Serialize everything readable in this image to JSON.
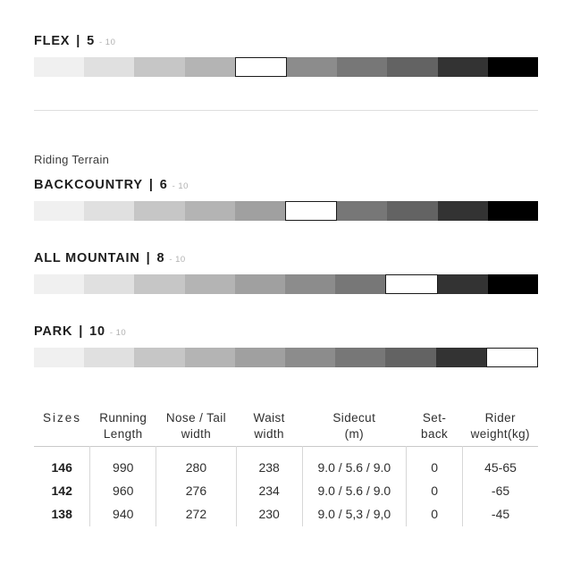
{
  "flex": {
    "name": "FLEX",
    "separator": "|",
    "value": "5",
    "max": "- 10",
    "rating": 5,
    "scale_steps": 10
  },
  "riding_terrain": {
    "label": "Riding Terrain",
    "items": [
      {
        "name": "BACKCOUNTRY",
        "separator": "|",
        "value": "6",
        "max": "- 10",
        "rating": 6,
        "scale_steps": 10
      },
      {
        "name": "ALL MOUNTAIN",
        "separator": "|",
        "value": "8",
        "max": "- 10",
        "rating": 8,
        "scale_steps": 10
      },
      {
        "name": "PARK",
        "separator": "|",
        "value": "10",
        "max": "- 10",
        "rating": 10,
        "scale_steps": 10
      }
    ]
  },
  "scale_colors": [
    "#f0f0f0",
    "#e0e0e0",
    "#c6c6c6",
    "#b4b4b4",
    "#a0a0a0",
    "#8c8c8c",
    "#777777",
    "#636363",
    "#333333",
    "#000000"
  ],
  "spec_table": {
    "headers": [
      "Sizes",
      "Running\nLength",
      "Nose / Tail\nwidth",
      "Waist\nwidth",
      "Sidecut\n(m)",
      "Set-\nback",
      "Rider\nweight(kg)"
    ],
    "rows": [
      [
        "146",
        "990",
        "280",
        "238",
        "9.0 / 5.6 / 9.0",
        "0",
        "45-65"
      ],
      [
        "142",
        "960",
        "276",
        "234",
        "9.0 / 5.6 / 9.0",
        "0",
        "-65"
      ],
      [
        "138",
        "940",
        "272",
        "230",
        "9.0 / 5,3 / 9,0",
        "0",
        "-45"
      ]
    ]
  }
}
